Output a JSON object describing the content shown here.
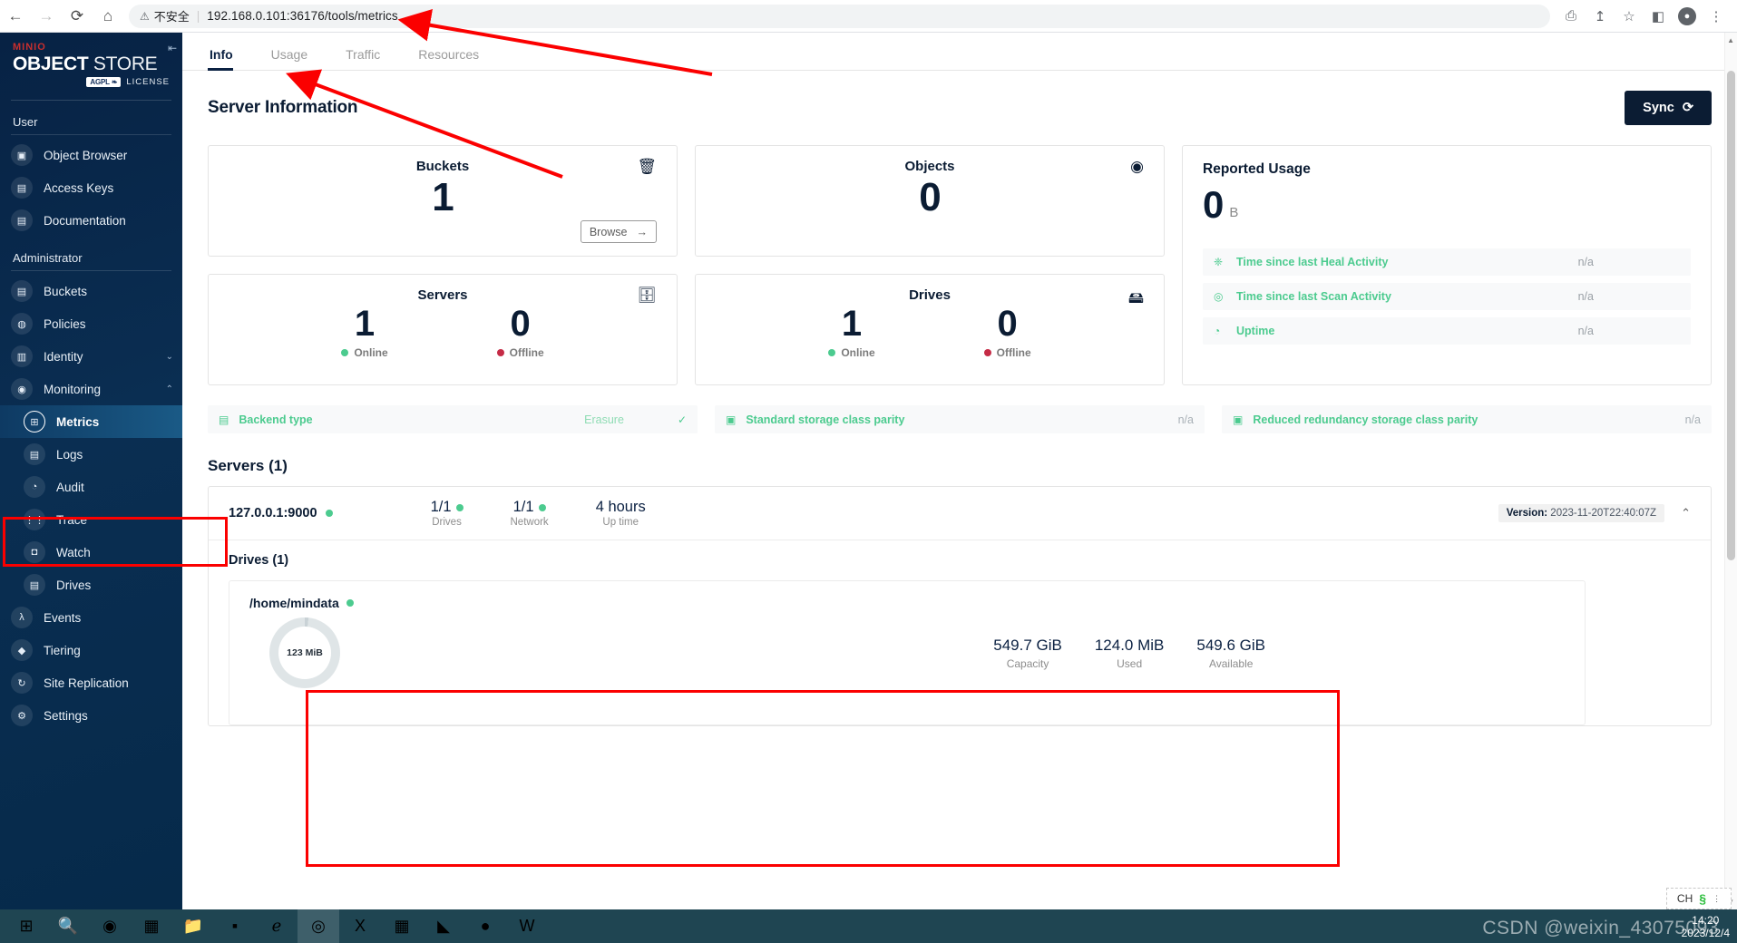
{
  "browser": {
    "back_icon": "back-arrow-icon",
    "forward_icon": "forward-arrow-icon",
    "reload_icon": "reload-icon",
    "home_icon": "home-icon",
    "warning_icon": "warning-triangle-icon",
    "security_label": "不安全",
    "url": "192.168.0.101:36176/tools/metrics",
    "translate_icon": "translate-icon",
    "share_icon": "share-icon",
    "bookmark_icon": "star-icon",
    "sidepanel_icon": "side-panel-icon",
    "profile_icon": "profile-avatar-icon",
    "menu_icon": "kebab-menu-icon"
  },
  "sidebar": {
    "logo": {
      "mini": "MINIO",
      "bold": "OBJECT",
      "light": " STORE",
      "badge": "AGPL",
      "license": "LICENSE"
    },
    "collapse_icon": "collapse-sidebar-icon",
    "groups": [
      {
        "label": "User",
        "items": [
          {
            "label": "Object Browser",
            "icon": "object-browser-icon",
            "glyph": "▣"
          },
          {
            "label": "Access Keys",
            "icon": "access-keys-icon",
            "glyph": "▤"
          },
          {
            "label": "Documentation",
            "icon": "documentation-icon",
            "glyph": "▤"
          }
        ]
      },
      {
        "label": "Administrator",
        "items": [
          {
            "label": "Buckets",
            "icon": "bucket-icon",
            "glyph": "▤"
          },
          {
            "label": "Policies",
            "icon": "policy-lock-icon",
            "glyph": "◍"
          },
          {
            "label": "Identity",
            "icon": "identity-icon",
            "glyph": "▥",
            "chevron": "⌄"
          },
          {
            "label": "Monitoring",
            "icon": "monitoring-icon",
            "glyph": "◉",
            "chevron": "⌃"
          },
          {
            "label": "Metrics",
            "icon": "metrics-icon",
            "glyph": "⊞",
            "sub": true,
            "active": true
          },
          {
            "label": "Logs",
            "icon": "logs-icon",
            "glyph": "▤",
            "sub": true
          },
          {
            "label": "Audit",
            "icon": "audit-icon",
            "glyph": "◔",
            "sub": true
          },
          {
            "label": "Trace",
            "icon": "trace-icon",
            "glyph": "⋮⋮",
            "sub": true
          },
          {
            "label": "Watch",
            "icon": "watch-icon",
            "glyph": "◘",
            "sub": true
          },
          {
            "label": "Drives",
            "icon": "drives-icon",
            "glyph": "▤",
            "sub": true
          },
          {
            "label": "Events",
            "icon": "events-lambda-icon",
            "glyph": "λ"
          },
          {
            "label": "Tiering",
            "icon": "tiering-layers-icon",
            "glyph": "◆"
          },
          {
            "label": "Site Replication",
            "icon": "site-replication-icon",
            "glyph": "↻"
          },
          {
            "label": "Settings",
            "icon": "settings-gear-icon",
            "glyph": "⚙"
          }
        ]
      }
    ]
  },
  "tabs": [
    {
      "label": "Info",
      "active": true
    },
    {
      "label": "Usage",
      "active": false
    },
    {
      "label": "Traffic",
      "active": false
    },
    {
      "label": "Resources",
      "active": false
    }
  ],
  "page": {
    "title": "Server Information",
    "sync_label": "Sync",
    "sync_icon": "sync-refresh-icon"
  },
  "cards": {
    "buckets": {
      "title": "Buckets",
      "value": "1",
      "icon": "bucket-icon",
      "browse_label": "Browse",
      "browse_arrow": "→"
    },
    "objects": {
      "title": "Objects",
      "value": "0",
      "icon": "objects-globe-icon"
    },
    "servers": {
      "title": "Servers",
      "icon": "servers-database-icon",
      "online_value": "1",
      "online_label": "Online",
      "offline_value": "0",
      "offline_label": "Offline"
    },
    "drives": {
      "title": "Drives",
      "icon": "drive-icon",
      "online_value": "1",
      "online_label": "Online",
      "offline_value": "0",
      "offline_label": "Offline"
    }
  },
  "reported_usage": {
    "title": "Reported Usage",
    "value": "0",
    "unit": "B",
    "rows": [
      {
        "label": "Time since last Heal Activity",
        "value": "n/a",
        "icon": "heal-activity-icon",
        "glyph": "❈"
      },
      {
        "label": "Time since last Scan Activity",
        "value": "n/a",
        "icon": "scan-activity-icon",
        "glyph": "◎"
      },
      {
        "label": "Uptime",
        "value": "n/a",
        "icon": "uptime-clock-icon",
        "glyph": "◔"
      }
    ]
  },
  "parity": [
    {
      "label": "Backend type",
      "value": "Erasure",
      "check": "✓",
      "icon": "backend-type-icon",
      "glyph": "▤"
    },
    {
      "label": "Standard storage class parity",
      "value": "n/a",
      "icon": "storage-parity-icon",
      "glyph": "▣"
    },
    {
      "label": "Reduced redundancy storage class parity",
      "value": "n/a",
      "icon": "redundancy-parity-icon",
      "glyph": "▣"
    }
  ],
  "servers_section": {
    "title": "Servers (1)",
    "server": {
      "name": "127.0.0.1:9000",
      "status": "online",
      "metrics": [
        {
          "value": "1/1",
          "label": "Drives",
          "dot": "green"
        },
        {
          "value": "1/1",
          "label": "Network",
          "dot": "green"
        },
        {
          "value": "4 hours",
          "label": "Up time",
          "dot": "none"
        }
      ],
      "version_label": "Version:",
      "version_value": "2023-11-20T22:40:07Z",
      "collapse_icon": "chevron-up-icon"
    },
    "drives_title": "Drives (1)",
    "drive": {
      "path": "/home/mindata",
      "status": "online",
      "donut_label": "123 MiB",
      "stats": [
        {
          "value": "549.7 GiB",
          "label": "Capacity"
        },
        {
          "value": "124.0 MiB",
          "label": "Used"
        },
        {
          "value": "549.6 GiB",
          "label": "Available"
        }
      ]
    }
  },
  "taskbar": {
    "items": [
      {
        "icon": "windows-start-icon",
        "glyph": "⊞"
      },
      {
        "icon": "search-icon",
        "glyph": "🔍"
      },
      {
        "icon": "edge-browser-icon",
        "glyph": "◉"
      },
      {
        "icon": "remote-desktop-icon",
        "glyph": "▦"
      },
      {
        "icon": "file-explorer-icon",
        "glyph": "📁"
      },
      {
        "icon": "terminal-icon",
        "glyph": "▪"
      },
      {
        "icon": "internet-explorer-icon",
        "glyph": "ℯ"
      },
      {
        "icon": "chrome-browser-icon",
        "glyph": "◎",
        "active": true
      },
      {
        "icon": "excel-icon",
        "glyph": "X"
      },
      {
        "icon": "xshell-icon",
        "glyph": "▦"
      },
      {
        "icon": "xftp-icon",
        "glyph": "◣"
      },
      {
        "icon": "wechat-icon",
        "glyph": "●"
      },
      {
        "icon": "word-icon",
        "glyph": "W"
      }
    ],
    "ime": {
      "lang": "CH",
      "sogou_icon": "sogou-ime-icon"
    },
    "clock": {
      "time": "14:20",
      "date": "2023/12/4"
    },
    "watermark": "CSDN @weixin_43075093"
  }
}
